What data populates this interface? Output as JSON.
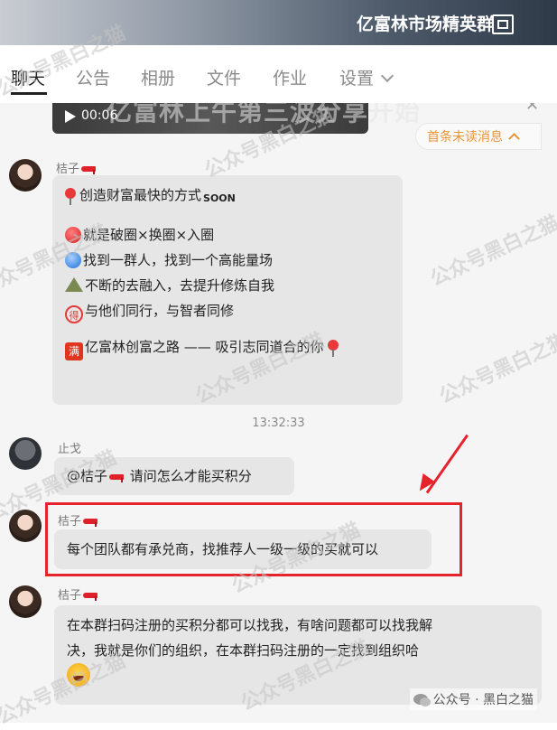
{
  "header": {
    "title": "亿富林市场精英群"
  },
  "tabs": [
    {
      "label": "聊天"
    },
    {
      "label": "公告"
    },
    {
      "label": "相册"
    },
    {
      "label": "文件"
    },
    {
      "label": "作业"
    },
    {
      "label": "设置"
    }
  ],
  "video": {
    "time": "00:06",
    "overlay_text": "亿富林上午第三波分享开始"
  },
  "unread": {
    "label": "首条未读消息"
  },
  "messages": [
    {
      "sender": "桔子",
      "lines": {
        "l1": "创造财富最快的方式",
        "l1_badge": "SOON",
        "l2": "就是破圈×换圈×入圈",
        "l3": "找到一群人，找到一个高能量场",
        "l4": "不断的去融入，去提升修炼自我",
        "l5_badge": "得",
        "l5": "与他们同行，与智者同修",
        "l6_badge": "满",
        "l6": "亿富林创富之路 —— 吸引志同道合的你"
      }
    },
    {
      "time": "13:32:33"
    },
    {
      "sender": "止戈",
      "text_prefix": "@桔子",
      "text": " 请问怎么才能买积分"
    },
    {
      "sender": "桔子",
      "text": "每个团队都有承兑商，找推荐人一级一级的买就可以"
    },
    {
      "sender": "桔子",
      "line1": "在本群扫码注册的买积分都可以找我，有啥问题都可以找我解",
      "line2": "决，我就是你们的组织，在本群扫码注册的一定找到组织哈"
    }
  ],
  "watermark": {
    "text": "公众号黑白之猫"
  },
  "footer": {
    "text": "公众号 · 黑白之猫"
  },
  "colors": {
    "highlight": "#e5232c",
    "unread": "#e9953a"
  }
}
